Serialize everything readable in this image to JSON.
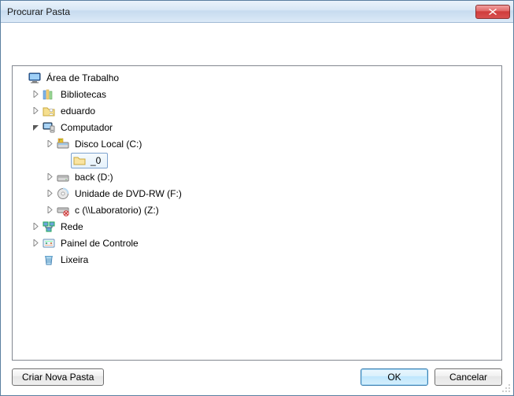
{
  "window": {
    "title": "Procurar Pasta"
  },
  "tree": {
    "desktop": "Área de Trabalho",
    "libraries": "Bibliotecas",
    "user": "eduardo",
    "computer": "Computador",
    "disk_c": "Disco Local (C:)",
    "folder_selected": "_0",
    "disk_d": "back (D:)",
    "dvd": "Unidade de DVD-RW (F:)",
    "netdrive": "c (\\\\Laboratorio) (Z:)",
    "network": "Rede",
    "control_panel": "Painel de Controle",
    "recycle": "Lixeira"
  },
  "buttons": {
    "new_folder": "Criar Nova Pasta",
    "ok": "OK",
    "cancel": "Cancelar"
  }
}
